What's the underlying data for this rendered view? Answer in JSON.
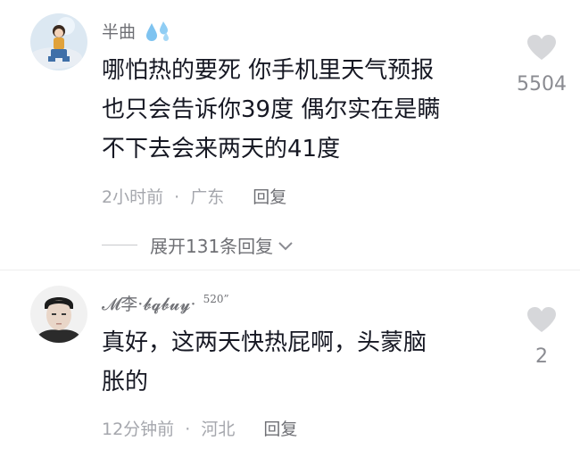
{
  "comments": [
    {
      "username": "半曲",
      "text_lines": [
        "哪怕热的要死 你手机里天气预报",
        "也只会告诉你39度 偶尔实在是瞒",
        "不下去会来两天的41度"
      ],
      "time": "2小时前",
      "location": "广东",
      "reply_label": "回复",
      "likes": "5504",
      "expand_label": "展开131条回复"
    },
    {
      "username": "𝓜李·𝓫𝓺𝓫𝓾𝔂·",
      "username_suffix": "520”",
      "text_lines": [
        "真好，这两天快热屁啊，头蒙脑",
        "胀的"
      ],
      "time": "12分钟前",
      "location": "河北",
      "reply_label": "回复",
      "likes": "2"
    }
  ],
  "separator": "·",
  "colors": {
    "text": "#161823",
    "muted": "#a5a7ad",
    "secondary": "#6f7075",
    "heart": "#d6d7da"
  }
}
